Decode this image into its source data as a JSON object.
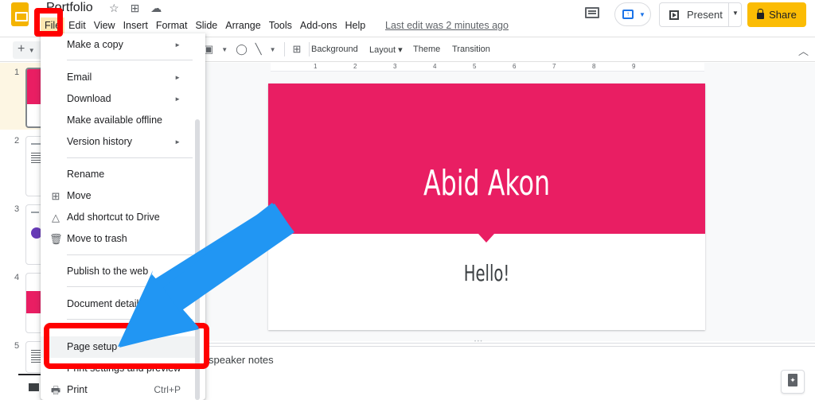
{
  "header": {
    "title": "Portfolio",
    "menus": [
      "File",
      "Edit",
      "View",
      "Insert",
      "Format",
      "Slide",
      "Arrange",
      "Tools",
      "Add-ons",
      "Help"
    ],
    "active_menu": "File",
    "last_edit": "Last edit was 2 minutes ago",
    "present_label": "Present",
    "share_label": "Share",
    "icons": [
      "star-icon",
      "move-to-folder-icon",
      "cloud-saved-icon",
      "comment-history-icon",
      "present-to-meeting-icon",
      "lock-icon"
    ]
  },
  "toolbar": {
    "add_icon": "+",
    "background_label": "Background",
    "layout_label": "Layout",
    "theme_label": "Theme",
    "transition_label": "Transition",
    "collapse_icon": "^"
  },
  "ruler": {
    "ticks": [
      "1",
      "2",
      "3",
      "4",
      "5",
      "6",
      "7",
      "8",
      "9"
    ]
  },
  "filmstrip": {
    "slides": [
      {
        "number": "1",
        "selected": true
      },
      {
        "number": "2",
        "selected": false
      },
      {
        "number": "3",
        "selected": false
      },
      {
        "number": "4",
        "selected": false
      },
      {
        "number": "5",
        "selected": false
      }
    ]
  },
  "slide": {
    "title": "Abid Akon",
    "subtitle": "Hello!",
    "band_color": "#e91e63"
  },
  "notes": {
    "placeholder": "speaker notes"
  },
  "file_menu": {
    "items": [
      {
        "label": "Make a copy",
        "submenu": true
      },
      {
        "label": "Email",
        "submenu": true
      },
      {
        "label": "Download",
        "submenu": true
      },
      {
        "label": "Make available offline",
        "submenu": false
      },
      {
        "label": "Version history",
        "submenu": true
      },
      {
        "label": "Rename",
        "submenu": false
      },
      {
        "label": "Move",
        "icon": "move-folder-icon"
      },
      {
        "label": "Add shortcut to Drive",
        "icon": "drive-shortcut-icon"
      },
      {
        "label": "Move to trash",
        "icon": "trash-icon"
      },
      {
        "label": "Publish to the web",
        "submenu": false
      },
      {
        "label": "Document details",
        "submenu": false
      },
      {
        "label": "Page setup",
        "submenu": false,
        "highlighted": true
      },
      {
        "label": "Print settings and preview",
        "submenu": false
      },
      {
        "label": "Print",
        "icon": "print-icon",
        "shortcut": "Ctrl+P"
      }
    ]
  },
  "annotations": {
    "highlight_color": "#ff0000",
    "arrow_color": "#2196f3",
    "targets": [
      "File",
      "Page setup"
    ]
  }
}
